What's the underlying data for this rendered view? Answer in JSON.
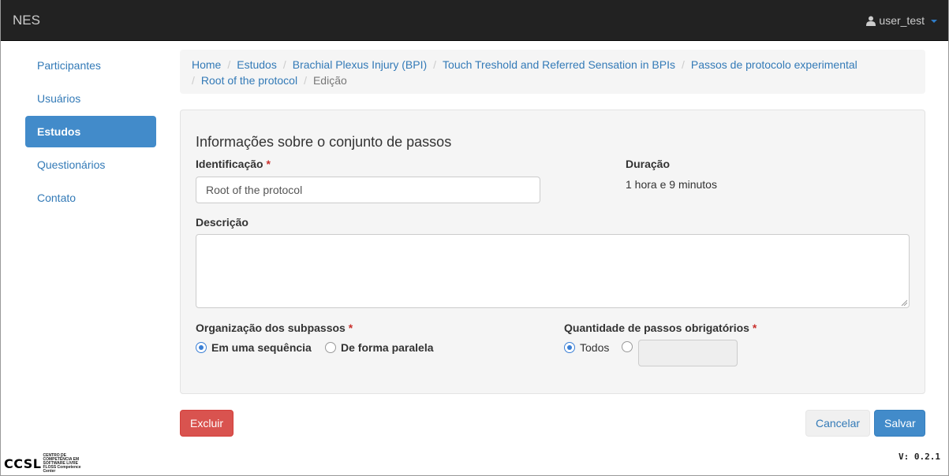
{
  "navbar": {
    "brand": "NES",
    "user": "user_test"
  },
  "sidebar": {
    "items": [
      {
        "label": "Participantes"
      },
      {
        "label": "Usuários"
      },
      {
        "label": "Estudos",
        "active": true
      },
      {
        "label": "Questionários"
      },
      {
        "label": "Contato"
      }
    ]
  },
  "breadcrumb": {
    "items": [
      "Home",
      "Estudos",
      "Brachial Plexus Injury (BPI)",
      "Touch Treshold and Referred Sensation in BPIs",
      "Passos de protocolo experimental",
      "Root of the protocol"
    ],
    "current": "Edição",
    "separator": "/"
  },
  "form": {
    "title": "Informações sobre o conjunto de passos",
    "identificacao_label": "Identificação",
    "identificacao_value": "Root of the protocol",
    "required_mark": "*",
    "duracao_label": "Duração",
    "duracao_value": "1 hora e 9 minutos",
    "descricao_label": "Descrição",
    "descricao_value": "",
    "organizacao_label": "Organização dos subpassos",
    "organizacao_options": [
      "Em uma sequência",
      "De forma paralela"
    ],
    "organizacao_selected": "Em uma sequência",
    "quantidade_label": "Quantidade de passos obrigatórios",
    "quantidade_options": [
      "Todos"
    ],
    "quantidade_selected": "Todos",
    "quantidade_value": ""
  },
  "actions": {
    "delete_label": "Excluir",
    "cancel_label": "Cancelar",
    "save_label": "Salvar"
  },
  "footer": {
    "logo_text": "CCSL",
    "logo_subtext": "CENTRO DE COMPETÊNCIA EM SOFTWARE LIVRE FLOSS Competence Center",
    "version": "V: 0.2.1"
  },
  "colors": {
    "navbar_bg": "#222222",
    "link": "#337ab7",
    "active": "#428bca",
    "danger": "#d9534f",
    "required": "#c9302c"
  }
}
